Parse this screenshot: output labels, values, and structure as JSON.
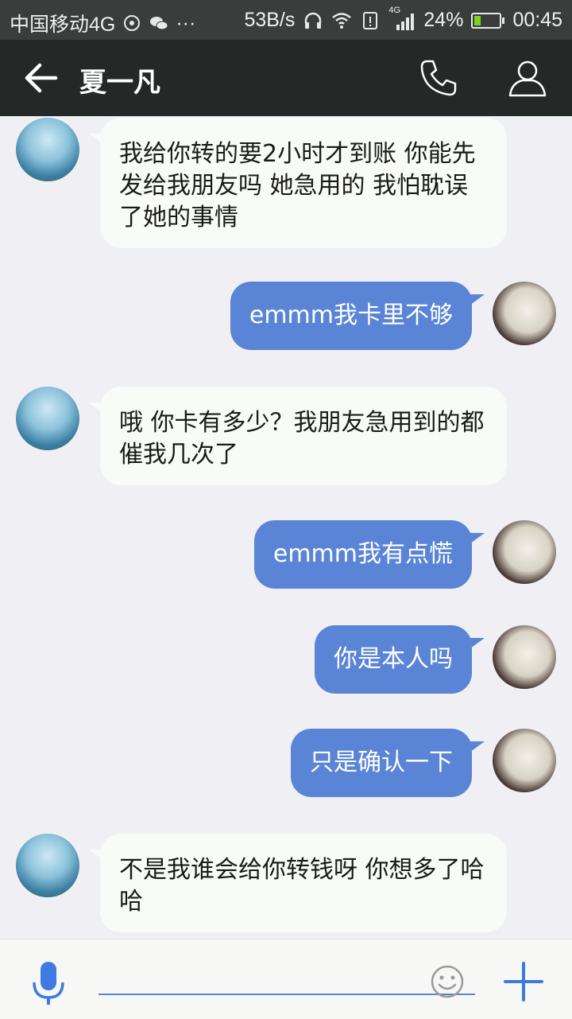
{
  "status_bar": {
    "carrier": "中国移动4G",
    "speed": "53B/s",
    "network_tag": "4G",
    "battery": "24%",
    "battery_level": 0.24,
    "time": "00:45"
  },
  "header": {
    "title": "夏一凡",
    "back_icon": "back-arrow-icon",
    "call_icon": "phone-icon",
    "profile_icon": "person-icon"
  },
  "messages": [
    {
      "from": "friend",
      "text": "我给你转的要2小时才到账 你能先发给我朋友吗 她急用的 我怕耽误了她的事情"
    },
    {
      "from": "me",
      "text": "emmm我卡里不够"
    },
    {
      "from": "friend",
      "text": "哦 你卡有多少？我朋友急用到的都催我几次了"
    },
    {
      "from": "me",
      "text": "emmm我有点慌"
    },
    {
      "from": "me",
      "text": "你是本人吗"
    },
    {
      "from": "me",
      "text": "只是确认一下"
    },
    {
      "from": "friend",
      "text": "不是我谁会给你转钱呀 你想多了哈哈"
    }
  ],
  "input_bar": {
    "voice_icon": "microphone-icon",
    "emoji_icon": "smiley-icon",
    "more_icon": "plus-icon",
    "input_value": ""
  },
  "colors": {
    "outgoing_bubble": "#5a84d6",
    "incoming_bubble": "#f8fbf7",
    "header_bg": "#242826",
    "background": "#efeff4"
  }
}
